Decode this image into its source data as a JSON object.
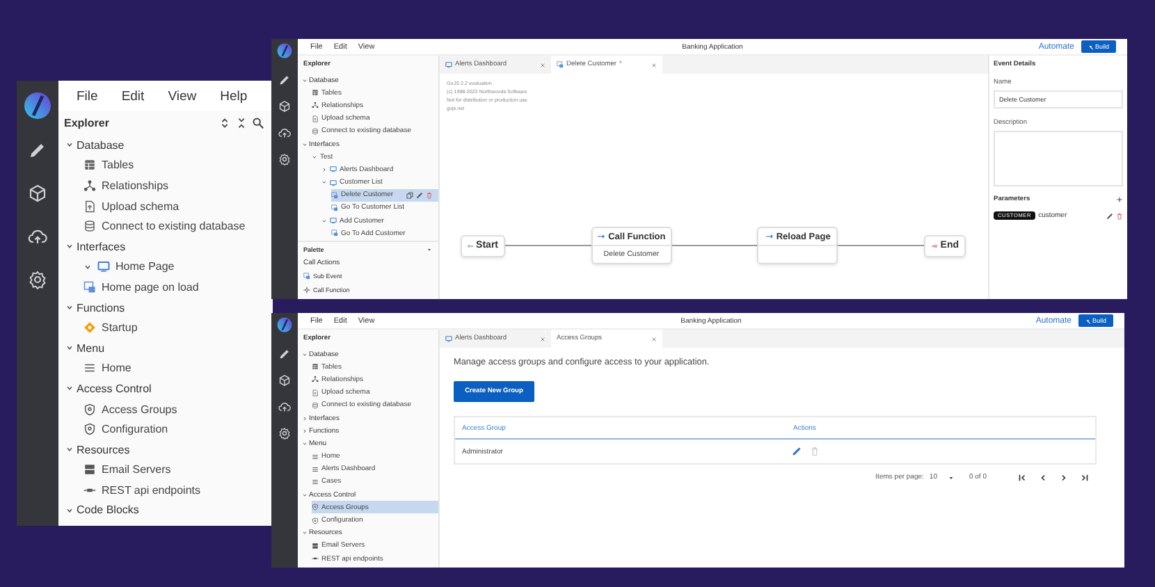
{
  "editor_panel": {
    "menu": [
      "File",
      "Edit",
      "View",
      "Help"
    ],
    "explorer_title": "Explorer",
    "tree": [
      {
        "label": "Database",
        "expanded": true,
        "selected": false,
        "children": [
          {
            "label": "Tables",
            "kind": "table",
            "selected": false
          },
          {
            "label": "Relationships",
            "kind": "relationship",
            "selected": false
          },
          {
            "label": "Upload schema",
            "kind": "upload",
            "selected": false
          },
          {
            "label": "Connect to existing database",
            "kind": "database",
            "selected": false
          }
        ]
      },
      {
        "label": "Interfaces",
        "expanded": true,
        "selected": false,
        "children": [
          {
            "label": "Home Page",
            "kind": "page",
            "expanded": true,
            "selected": false
          },
          {
            "label": "Home page on load",
            "kind": "event",
            "selected": false
          }
        ]
      },
      {
        "label": "Functions",
        "expanded": true,
        "selected": false,
        "children": [
          {
            "label": "Startup",
            "kind": "function",
            "selected": false
          }
        ]
      },
      {
        "label": "Menu",
        "expanded": true,
        "selected": false,
        "children": [
          {
            "label": "Home",
            "kind": "menu",
            "selected": false
          }
        ]
      },
      {
        "label": "Access Control",
        "expanded": true,
        "selected": false,
        "children": [
          {
            "label": "Access Groups",
            "kind": "shield",
            "selected": false
          },
          {
            "label": "Configuration",
            "kind": "shield",
            "selected": false
          }
        ]
      },
      {
        "label": "Resources",
        "expanded": true,
        "selected": false,
        "children": [
          {
            "label": "Email Servers",
            "kind": "server",
            "selected": false
          },
          {
            "label": "REST api endpoints",
            "kind": "api",
            "selected": false
          }
        ]
      },
      {
        "label": "Code Blocks",
        "expanded": true,
        "selected": false
      }
    ]
  },
  "flow_window": {
    "menu": [
      "File",
      "Edit",
      "View"
    ],
    "title": "Banking Application",
    "automate": "Automate",
    "build": "Build",
    "explorer_title": "Explorer",
    "tree": [
      {
        "label": "Database",
        "expanded": true,
        "selected": false,
        "children": [
          {
            "label": "Tables",
            "kind": "table",
            "selected": false
          },
          {
            "label": "Relationships",
            "kind": "relationship",
            "selected": false
          },
          {
            "label": "Upload schema",
            "kind": "upload",
            "selected": false
          },
          {
            "label": "Connect to existing database",
            "kind": "database",
            "selected": false
          }
        ]
      },
      {
        "label": "Interfaces",
        "expanded": true,
        "selected": false,
        "children": [
          {
            "label": "Test",
            "expanded": true,
            "selected": false,
            "children": [
              {
                "label": "Alerts Dashboard",
                "kind": "page",
                "expanded": false,
                "selected": false
              },
              {
                "label": "Customer List",
                "kind": "page",
                "expanded": true,
                "selected": false,
                "children": [
                  {
                    "label": "Delete Customer",
                    "kind": "event",
                    "selected": true,
                    "hover_actions": true
                  },
                  {
                    "label": "Go To Customer List",
                    "kind": "event",
                    "selected": false
                  }
                ]
              },
              {
                "label": "Add Customer",
                "kind": "page",
                "expanded": true,
                "selected": false,
                "children": [
                  {
                    "label": "Go To Add Customer",
                    "kind": "event",
                    "selected": false
                  }
                ]
              }
            ]
          }
        ]
      }
    ],
    "palette": {
      "title": "Palette",
      "group": "Call Actions",
      "items": [
        {
          "label": "Sub Event",
          "kind": "event"
        },
        {
          "label": "Call Function",
          "kind": "call"
        }
      ]
    },
    "tabs": [
      {
        "label": "Alerts Dashboard",
        "selected": false
      },
      {
        "label": "Delete Customer",
        "marker": "*",
        "selected": true
      }
    ],
    "canvas_notice": [
      "GoJS 2.2 evaluation",
      "(c) 1998-2022 Northwoods Software",
      "Not for distribution or production use",
      "gojs.net"
    ],
    "nodes": [
      {
        "kind": "start",
        "label": "Start"
      },
      {
        "kind": "action",
        "label": "Call Function",
        "detail": "Delete Customer"
      },
      {
        "kind": "action",
        "label": "Reload Page"
      },
      {
        "kind": "end",
        "label": "End"
      }
    ],
    "details": {
      "title": "Event Details",
      "name_label": "Name",
      "name_value": "Delete Customer",
      "description_label": "Description",
      "parameters_label": "Parameters",
      "parameters": [
        {
          "type": "CUSTOMER",
          "name": "customer"
        }
      ]
    }
  },
  "access_window": {
    "menu": [
      "File",
      "Edit",
      "View"
    ],
    "title": "Banking Application",
    "automate": "Automate",
    "build": "Build",
    "explorer_title": "Explorer",
    "tree": [
      {
        "label": "Database",
        "expanded": true,
        "selected": false,
        "children": [
          {
            "label": "Tables",
            "kind": "table",
            "selected": false
          },
          {
            "label": "Relationships",
            "kind": "relationship",
            "selected": false
          },
          {
            "label": "Upload schema",
            "kind": "upload",
            "selected": false
          },
          {
            "label": "Connect to existing database",
            "kind": "database",
            "selected": false
          }
        ]
      },
      {
        "label": "Interfaces",
        "expanded": false,
        "selected": false
      },
      {
        "label": "Functions",
        "expanded": false,
        "selected": false
      },
      {
        "label": "Menu",
        "expanded": true,
        "selected": false,
        "children": [
          {
            "label": "Home",
            "kind": "menu",
            "selected": false
          },
          {
            "label": "Alerts Dashboard",
            "kind": "menu",
            "selected": false
          },
          {
            "label": "Cases",
            "kind": "menu",
            "selected": false
          }
        ]
      },
      {
        "label": "Access Control",
        "expanded": true,
        "selected": false,
        "children": [
          {
            "label": "Access Groups",
            "kind": "shield",
            "selected": true
          },
          {
            "label": "Configuration",
            "kind": "shield",
            "selected": false
          }
        ]
      },
      {
        "label": "Resources",
        "expanded": true,
        "selected": false,
        "children": [
          {
            "label": "Email Servers",
            "kind": "server",
            "selected": false
          },
          {
            "label": "REST api endpoints",
            "kind": "api",
            "selected": false
          }
        ]
      }
    ],
    "tabs": [
      {
        "label": "Alerts Dashboard",
        "selected": false
      },
      {
        "label": "Access Groups",
        "selected": true
      }
    ],
    "intro": "Manage access groups and configure access to your application.",
    "create_button": "Create New Group",
    "columns": [
      "Access Group",
      "Actions"
    ],
    "rows": [
      {
        "name": "Administrator",
        "delete_disabled": true
      }
    ],
    "pagination": {
      "label": "Items per page:",
      "page_size": "10",
      "range": "0 of 0"
    }
  }
}
